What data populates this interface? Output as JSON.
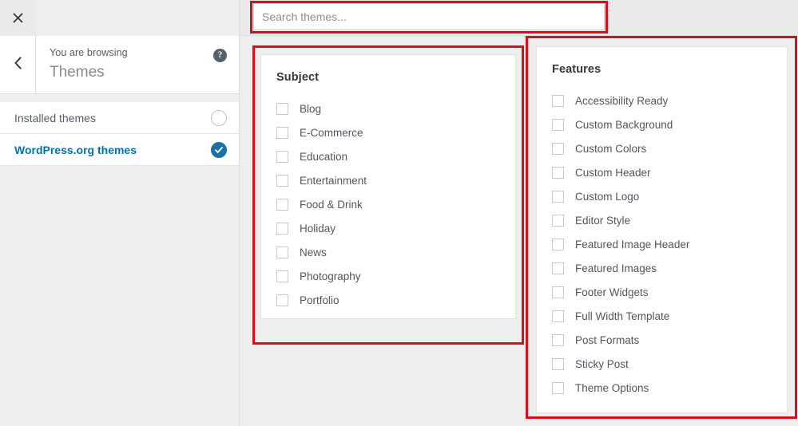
{
  "window": {
    "close_icon": "close-icon",
    "back_icon": "chevron-left-icon"
  },
  "sidebar": {
    "eyebrow": "You are browsing",
    "title": "Themes",
    "help_icon": "?",
    "items": [
      {
        "label": "Installed themes",
        "selected": false
      },
      {
        "label": "WordPress.org themes",
        "selected": true
      }
    ]
  },
  "search": {
    "value": "",
    "placeholder": "Search themes..."
  },
  "filters": [
    {
      "id": "subject",
      "title": "Subject",
      "options": [
        {
          "label": "Blog",
          "checked": false
        },
        {
          "label": "E-Commerce",
          "checked": false
        },
        {
          "label": "Education",
          "checked": false
        },
        {
          "label": "Entertainment",
          "checked": false
        },
        {
          "label": "Food & Drink",
          "checked": false
        },
        {
          "label": "Holiday",
          "checked": false
        },
        {
          "label": "News",
          "checked": false
        },
        {
          "label": "Photography",
          "checked": false
        },
        {
          "label": "Portfolio",
          "checked": false
        }
      ]
    },
    {
      "id": "features",
      "title": "Features",
      "options": [
        {
          "label": "Accessibility Ready",
          "checked": false
        },
        {
          "label": "Custom Background",
          "checked": false
        },
        {
          "label": "Custom Colors",
          "checked": false
        },
        {
          "label": "Custom Header",
          "checked": false
        },
        {
          "label": "Custom Logo",
          "checked": false
        },
        {
          "label": "Editor Style",
          "checked": false
        },
        {
          "label": "Featured Image Header",
          "checked": false
        },
        {
          "label": "Featured Images",
          "checked": false
        },
        {
          "label": "Footer Widgets",
          "checked": false
        },
        {
          "label": "Full Width Template",
          "checked": false
        },
        {
          "label": "Post Formats",
          "checked": false
        },
        {
          "label": "Sticky Post",
          "checked": false
        },
        {
          "label": "Theme Options",
          "checked": false
        }
      ]
    }
  ],
  "colors": {
    "accent": "#0073aa",
    "selected_radio": "#1a70a7",
    "annotation": "#d6101a",
    "panel_bg": "#eeeeee",
    "card_bg": "#ffffff"
  },
  "annotations": [
    {
      "name": "search-field-highlight"
    },
    {
      "name": "subject-filter-highlight"
    },
    {
      "name": "features-filter-highlight"
    }
  ]
}
